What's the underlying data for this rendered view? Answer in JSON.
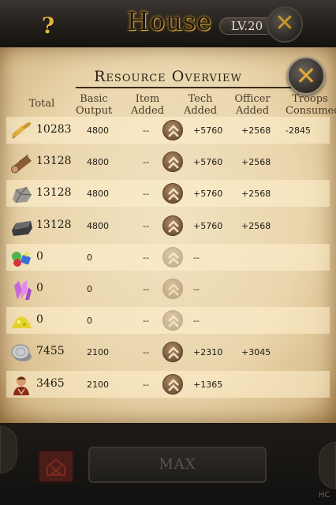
{
  "header": {
    "help_label": "?",
    "title": "House",
    "level": "LV.20",
    "close_label": "✕"
  },
  "overview": {
    "title": "Resource Overview",
    "close_label": "✕",
    "columns": {
      "total": "Total",
      "basic_output": "Basic Output",
      "item_added": "Item Added",
      "tech_added": "Tech Added",
      "officer_added": "Officer Added",
      "troops_consumed": "Troops Consumed"
    },
    "rows": [
      {
        "icon": "wheat-icon",
        "total": "10283",
        "basic": "4800",
        "item": "--",
        "tech": "+5760",
        "officer": "+2568",
        "troops": "-2845",
        "boost_enabled": true
      },
      {
        "icon": "log-icon",
        "total": "13128",
        "basic": "4800",
        "item": "--",
        "tech": "+5760",
        "officer": "+2568",
        "troops": "",
        "boost_enabled": true
      },
      {
        "icon": "stone-icon",
        "total": "13128",
        "basic": "4800",
        "item": "--",
        "tech": "+5760",
        "officer": "+2568",
        "troops": "",
        "boost_enabled": true
      },
      {
        "icon": "iron-icon",
        "total": "13128",
        "basic": "4800",
        "item": "--",
        "tech": "+5760",
        "officer": "+2568",
        "troops": "",
        "boost_enabled": true
      },
      {
        "icon": "gems-icon",
        "total": "0",
        "basic": "0",
        "item": "--",
        "tech": "--",
        "officer": "",
        "troops": "",
        "boost_enabled": false
      },
      {
        "icon": "crystal-icon",
        "total": "0",
        "basic": "0",
        "item": "--",
        "tech": "--",
        "officer": "",
        "troops": "",
        "boost_enabled": false
      },
      {
        "icon": "sulfur-icon",
        "total": "0",
        "basic": "0",
        "item": "--",
        "tech": "--",
        "officer": "",
        "troops": "",
        "boost_enabled": false
      },
      {
        "icon": "silver-icon",
        "total": "7455",
        "basic": "2100",
        "item": "--",
        "tech": "+2310",
        "officer": "+3045",
        "troops": "",
        "boost_enabled": true
      },
      {
        "icon": "population-icon",
        "total": "3465",
        "basic": "2100",
        "item": "--",
        "tech": "+1365",
        "officer": "",
        "troops": "",
        "boost_enabled": true
      }
    ]
  },
  "footer": {
    "max_label": "MAX",
    "edge_text": "HC"
  },
  "colors": {
    "parchment": "#ead6ad",
    "ink": "#1e1a15",
    "gold": "#e0a83a",
    "demolish": "#4a1d18"
  }
}
